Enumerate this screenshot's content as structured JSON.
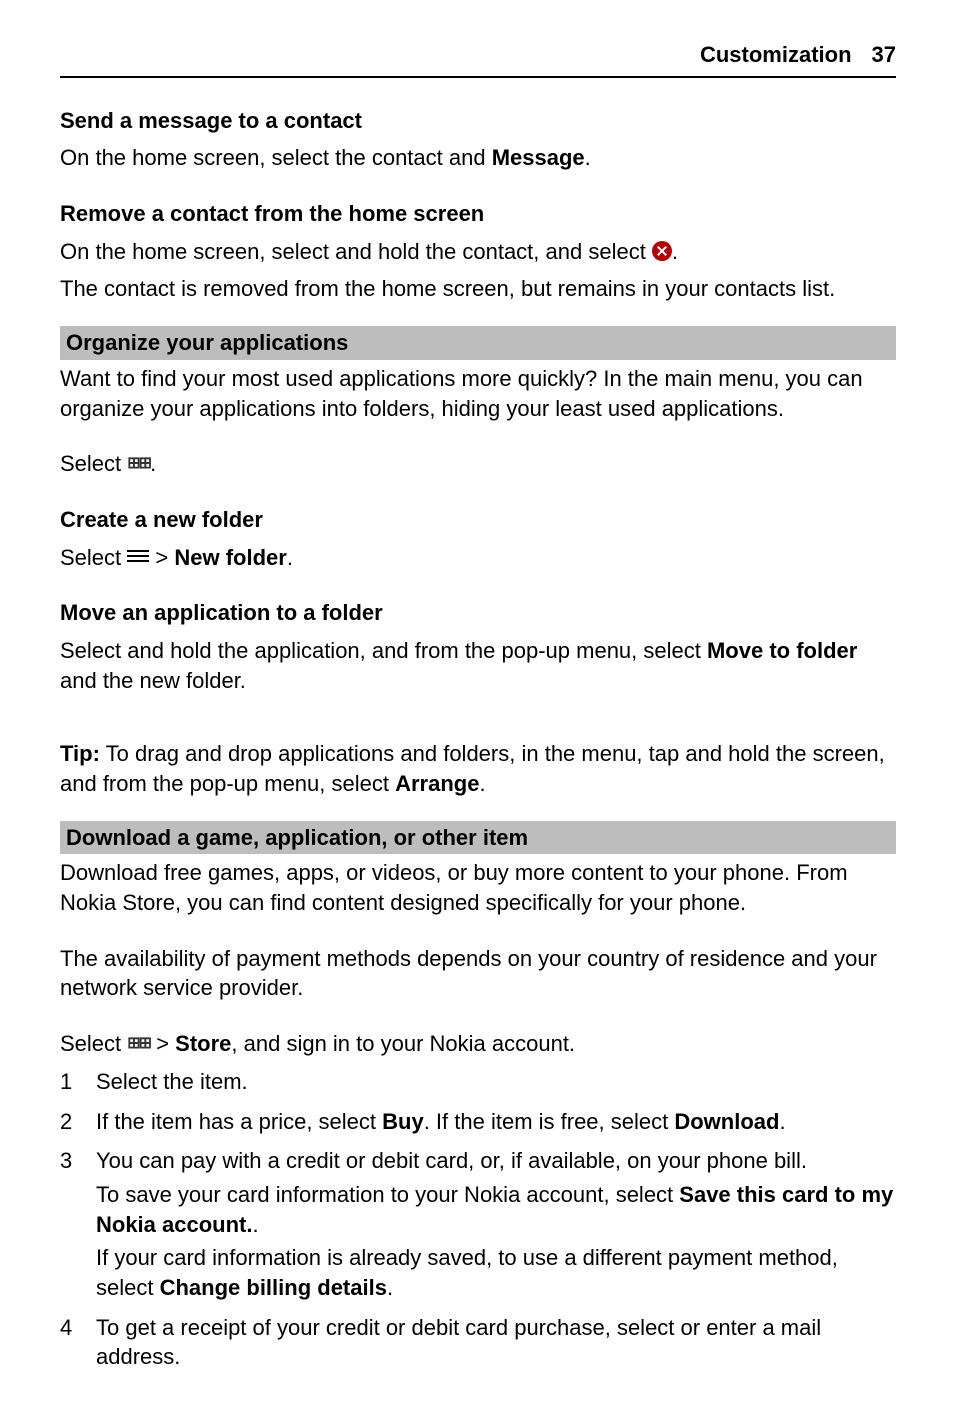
{
  "header": {
    "title": "Customization",
    "page": "37"
  },
  "s1": {
    "h": "Send a message to a contact",
    "p_a": "On the home screen, select the contact and ",
    "p_b": "Message",
    "p_c": "."
  },
  "s2": {
    "h": "Remove a contact from the home screen",
    "p1_a": "On the home screen, select and hold the contact, and select ",
    "p1_b": ".",
    "p2": "The contact is removed from the home screen, but remains in your contacts list."
  },
  "bar1": "Organize your applications",
  "org": {
    "intro": "Want to find your most used applications more quickly? In the main menu, you can organize your applications into folders, hiding your least used applications.",
    "select_a": "Select ",
    "select_b": "."
  },
  "s3": {
    "h": "Create a new folder",
    "a": "Select ",
    "gt": " > ",
    "b": "New folder",
    "c": "."
  },
  "s4": {
    "h": "Move an application to a folder",
    "p_a": "Select and hold the application, and from the pop-up menu, select ",
    "p_b": "Move to folder",
    "p_c": " and the new folder."
  },
  "tip": {
    "label": "Tip:",
    "a": " To drag and drop applications and folders, in the menu, tap and hold the screen, and from the pop-up menu, select ",
    "b": "Arrange",
    "c": "."
  },
  "bar2": "Download a game, application, or other item",
  "dl": {
    "p1": "Download free games, apps, or videos, or buy more content to your phone. From Nokia Store, you can find content designed specifically for your phone.",
    "p2": "The availability of payment methods depends on your country of residence and your network service provider.",
    "sel_a": "Select ",
    "sel_gt": " > ",
    "sel_b": "Store",
    "sel_c": ", and sign in to your Nokia account."
  },
  "steps": {
    "n1": "1",
    "n2": "2",
    "n3": "3",
    "n4": "4",
    "t1": "Select the item.",
    "t2_a": "If the item has a price, select ",
    "t2_b": "Buy",
    "t2_c": ". If the item is free, select ",
    "t2_d": "Download",
    "t2_e": ".",
    "t3a": "You can pay with a credit or debit card, or, if available, on your phone bill.",
    "t3b_a": "To save your card information to your Nokia account, select ",
    "t3b_b": "Save this card to my Nokia account.",
    "t3b_c": ".",
    "t3c_a": "If your card information is already saved, to use a different payment method, select ",
    "t3c_b": "Change billing details",
    "t3c_c": ".",
    "t4": "To get a receipt of your credit or debit card purchase, select or enter a mail address."
  }
}
